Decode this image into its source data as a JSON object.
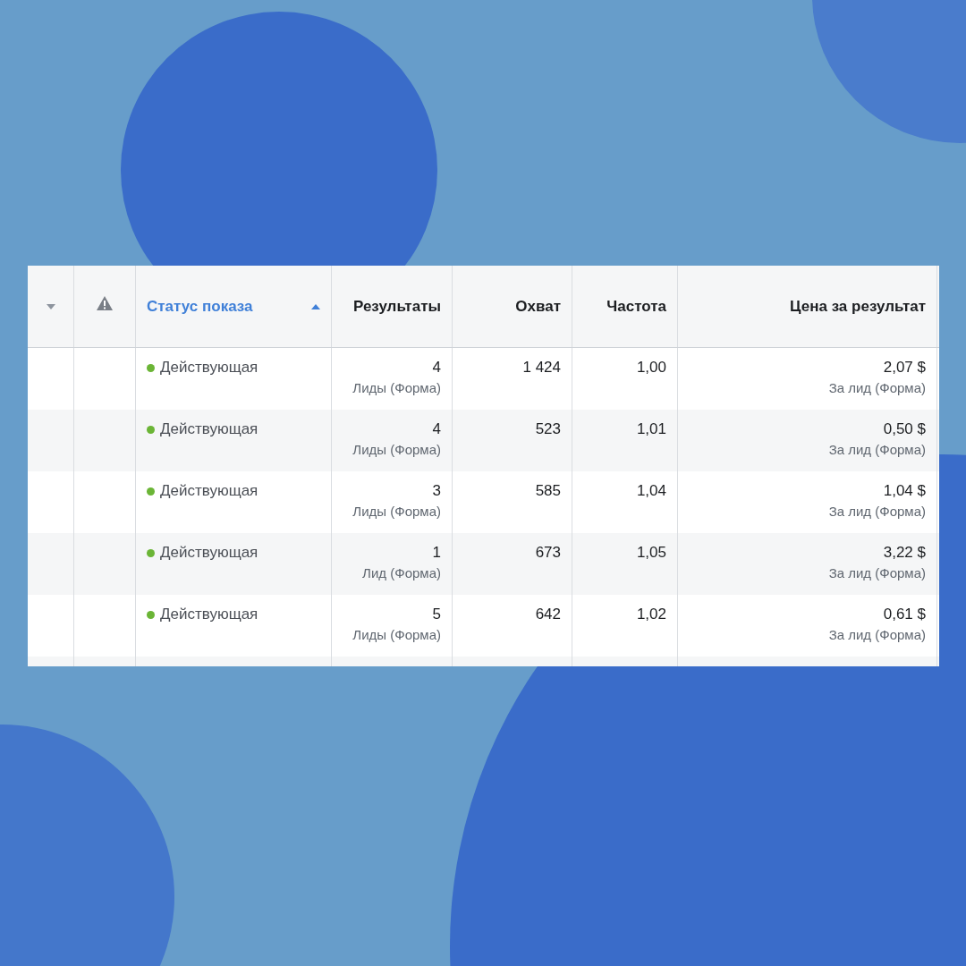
{
  "table": {
    "columns": [
      {
        "kind": "menu"
      },
      {
        "kind": "warning"
      },
      {
        "kind": "text",
        "label": "Статус показа",
        "sorted": true
      },
      {
        "kind": "num",
        "label": "Результаты",
        "sorted": false
      },
      {
        "kind": "num",
        "label": "Охват",
        "sorted": false
      },
      {
        "kind": "num",
        "label": "Частота",
        "sorted": false
      },
      {
        "kind": "num",
        "label": "Цена за результат",
        "sorted": false
      }
    ],
    "rows": [
      {
        "status": "Действующая",
        "color": "#6bb536",
        "results": "4",
        "results_unit": "Лиды (Форма)",
        "reach": "1 424",
        "frequency": "1,00",
        "cost": "2,07 $",
        "cost_unit": "За лид (Форма)"
      },
      {
        "status": "Действующая",
        "color": "#6bb536",
        "results": "4",
        "results_unit": "Лиды (Форма)",
        "reach": "523",
        "frequency": "1,01",
        "cost": "0,50 $",
        "cost_unit": "За лид (Форма)"
      },
      {
        "status": "Действующая",
        "color": "#6bb536",
        "results": "3",
        "results_unit": "Лиды (Форма)",
        "reach": "585",
        "frequency": "1,04",
        "cost": "1,04 $",
        "cost_unit": "За лид (Форма)"
      },
      {
        "status": "Действующая",
        "color": "#6bb536",
        "results": "1",
        "results_unit": "Лид (Форма)",
        "reach": "673",
        "frequency": "1,05",
        "cost": "3,22 $",
        "cost_unit": "За лид (Форма)"
      },
      {
        "status": "Действующая",
        "color": "#6bb536",
        "results": "5",
        "results_unit": "Лиды (Форма)",
        "reach": "642",
        "frequency": "1,02",
        "cost": "0,61 $",
        "cost_unit": "За лид (Форма)"
      }
    ]
  }
}
